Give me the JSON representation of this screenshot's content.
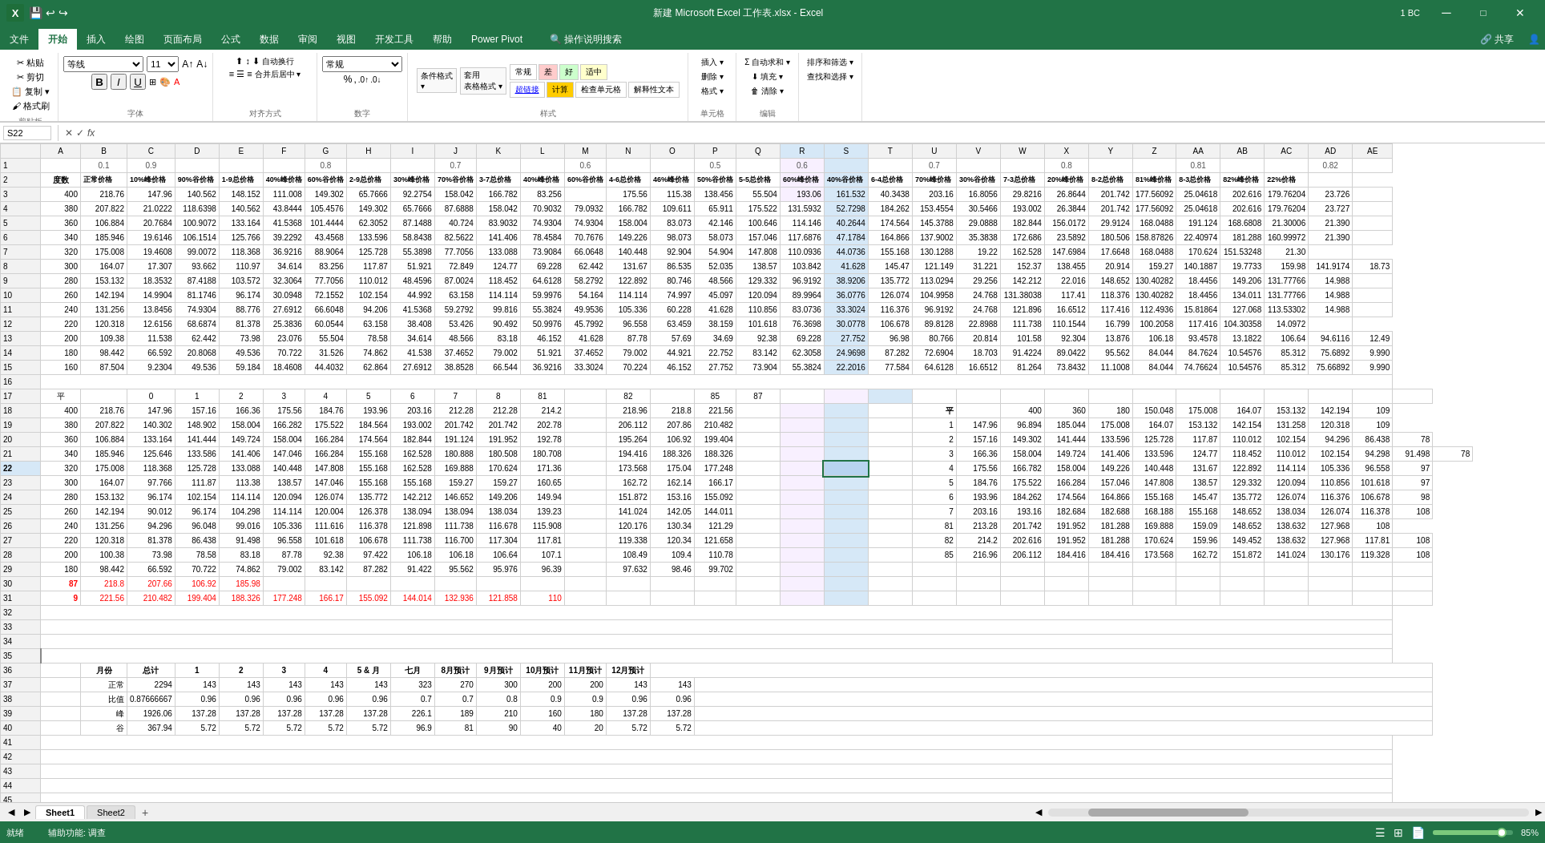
{
  "titleBar": {
    "icon": "X",
    "filename": "新建 Microsoft Excel 工作表.xlsx - Excel",
    "userInfo": "1 BC",
    "minimizeLabel": "─",
    "maximizeLabel": "□",
    "closeLabel": "✕"
  },
  "ribbonTabs": [
    {
      "label": "文件",
      "id": "file"
    },
    {
      "label": "开始",
      "id": "home",
      "active": true
    },
    {
      "label": "插入",
      "id": "insert"
    },
    {
      "label": "绘图",
      "id": "draw"
    },
    {
      "label": "页面布局",
      "id": "layout"
    },
    {
      "label": "公式",
      "id": "formula"
    },
    {
      "label": "数据",
      "id": "data"
    },
    {
      "label": "审阅",
      "id": "review"
    },
    {
      "label": "视图",
      "id": "view"
    },
    {
      "label": "开发工具",
      "id": "dev"
    },
    {
      "label": "帮助",
      "id": "help"
    },
    {
      "label": "Power Pivot",
      "id": "powerpivot"
    },
    {
      "label": "操作说明搜索",
      "id": "search"
    }
  ],
  "formulaBar": {
    "cellRef": "S22",
    "formula": ""
  },
  "sheetTabs": [
    {
      "label": "Sheet1",
      "active": true
    },
    {
      "label": "Sheet2"
    }
  ],
  "statusBar": {
    "readyLabel": "就绪",
    "assistLabel": "辅助功能: 调查",
    "zoomLevel": "85%"
  }
}
